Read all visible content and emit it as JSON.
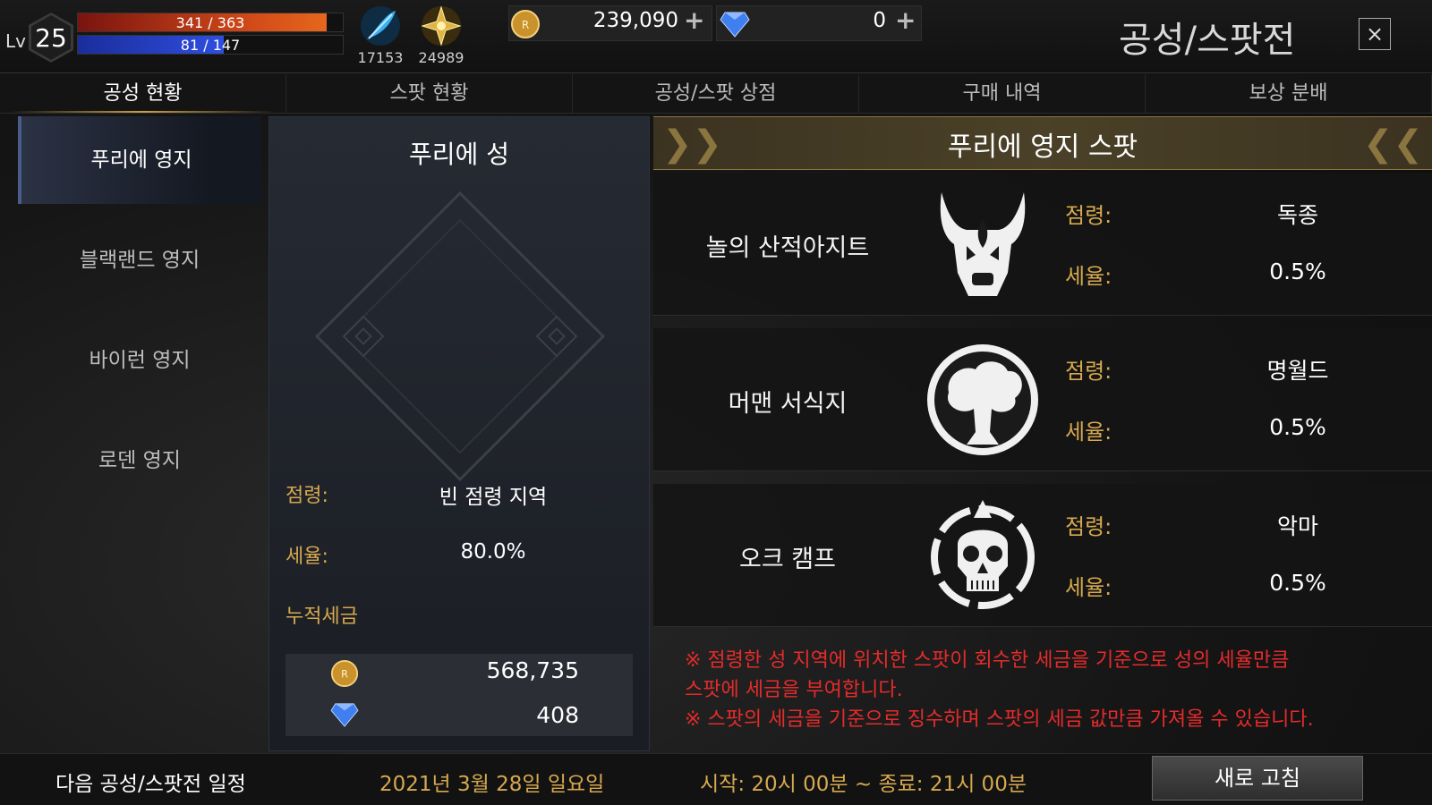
{
  "player": {
    "level_label": "Lv",
    "level": "25",
    "hp_text": "341 / 363",
    "hp_fraction": 0.9394,
    "mp_text": "81 / 147",
    "mp_fraction": 0.551
  },
  "currencies": {
    "feather": {
      "icon": "blue-feather-icon",
      "value": "17153"
    },
    "star": {
      "icon": "gold-star-icon",
      "value": "24989"
    },
    "gold": {
      "icon": "gold-coin-icon",
      "value": "239,090"
    },
    "diamond": {
      "icon": "blue-diamond-icon",
      "value": "0"
    }
  },
  "page_title": "공성/스팟전",
  "close_label": "×",
  "tabs": [
    {
      "label": "공성 현황"
    },
    {
      "label": "스팟 현황"
    },
    {
      "label": "공성/스팟 상점"
    },
    {
      "label": "구매 내역"
    },
    {
      "label": "보상 분배"
    }
  ],
  "territories": [
    {
      "label": "푸리에 영지"
    },
    {
      "label": "블랙랜드 영지"
    },
    {
      "label": "바이런 영지"
    },
    {
      "label": "로덴 영지"
    }
  ],
  "castle": {
    "title": "푸리에 성",
    "occupation_label": "점령:",
    "occupation_value": "빈 점령 지역",
    "tax_label": "세율:",
    "tax_value": "80.0%",
    "accumulated_label": "누적세금",
    "accumulated_gold": "568,735",
    "accumulated_diamond": "408"
  },
  "spot_header": "푸리에 영지 스팟",
  "spots": [
    {
      "name": "놀의 산적아지트",
      "icon": "bull-skull-icon",
      "occupation_label": "점령:",
      "occupation_value": "독종",
      "tax_label": "세율:",
      "tax_value": "0.5%"
    },
    {
      "name": "머맨 서식지",
      "icon": "tree-emblem-icon",
      "occupation_label": "점령:",
      "occupation_value": "명월드",
      "tax_label": "세율:",
      "tax_value": "0.5%"
    },
    {
      "name": "오크 캠프",
      "icon": "skull-emblem-icon",
      "occupation_label": "점령:",
      "occupation_value": "악마",
      "tax_label": "세율:",
      "tax_value": "0.5%"
    }
  ],
  "notice": [
    "※ 점령한 성 지역에 위치한 스팟이 회수한 세금을 기준으로 성의 세율만큼",
    "스팟에 세금을 부여합니다.",
    "※ 스팟의 세금을 기준으로 징수하며 스팟의 세금 값만큼 가져올 수 있습니다."
  ],
  "schedule": {
    "label": "다음 공성/스팟전 일정",
    "date": "2021년 3월 28일 일요일",
    "time": "시작: 20시 00분 ~ 종료: 21시 00분"
  },
  "refresh_label": "새로 고침",
  "colors": {
    "accent_gold": "#d6a94e",
    "notice_red": "#e52b2b",
    "hp_bar": "#d24a18",
    "mp_bar": "#2f4ee0",
    "date_gold": "#d6a94e"
  }
}
